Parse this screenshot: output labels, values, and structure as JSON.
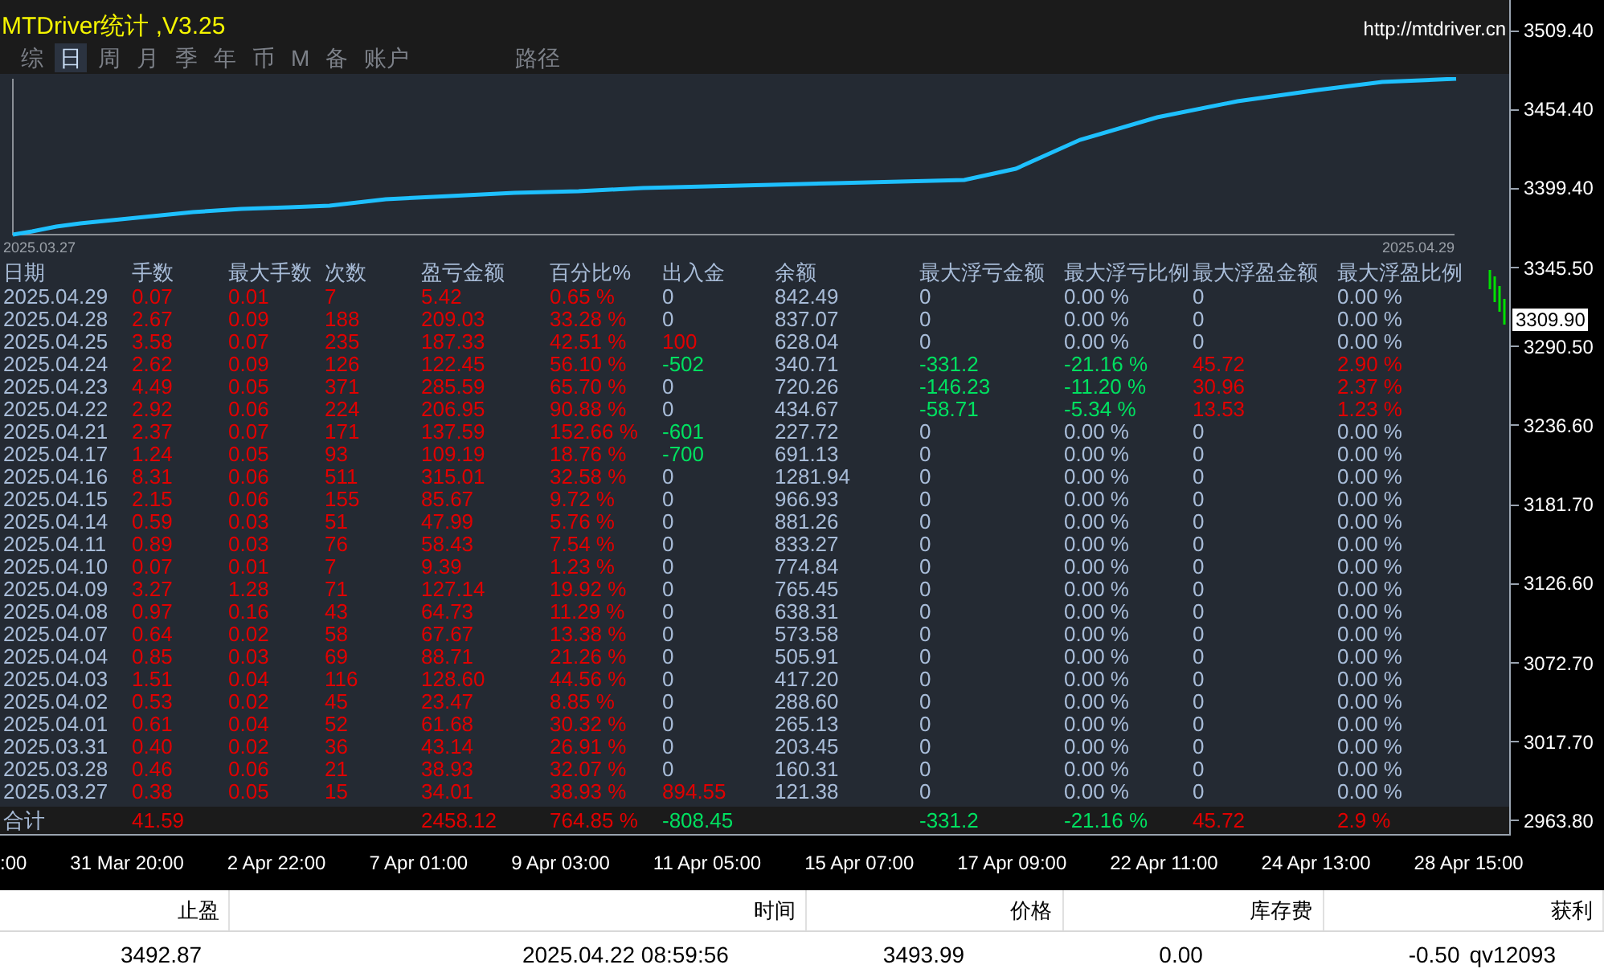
{
  "panel": {
    "title": "MTDriver统计 ,V3.25",
    "url": "http://mtdriver.cn",
    "tabs": [
      {
        "label": "综",
        "selected": false
      },
      {
        "label": "日",
        "selected": true
      },
      {
        "label": "周",
        "selected": false
      },
      {
        "label": "月",
        "selected": false
      },
      {
        "label": "季",
        "selected": false
      },
      {
        "label": "年",
        "selected": false
      },
      {
        "label": "币",
        "selected": false
      },
      {
        "label": "M",
        "selected": false
      },
      {
        "label": "备",
        "selected": false
      },
      {
        "label": "账户",
        "selected": false
      },
      {
        "label": "路径",
        "selected": false
      }
    ],
    "equity_chart": {
      "start_label": "2025.03.27",
      "end_label": "2025.04.29"
    },
    "table": {
      "columns": [
        {
          "label": "日期",
          "color": "#a8bcd8"
        },
        {
          "label": "手数",
          "color": "#e00000"
        },
        {
          "label": "最大手数",
          "color": "#e00000"
        },
        {
          "label": "次数",
          "color": "#e00000"
        },
        {
          "label": "盈亏金额",
          "color": "#e00000"
        },
        {
          "label": "百分比%",
          "color": "#e00000"
        },
        {
          "label": "出入金",
          "color": "#a8bcd8"
        },
        {
          "label": "余额",
          "color": "#a8bcd8"
        },
        {
          "label": "最大浮亏金额",
          "color": "#a8bcd8"
        },
        {
          "label": "最大浮亏比例",
          "color": "#a8bcd8"
        },
        {
          "label": "最大浮盈金额",
          "color": "#a8bcd8"
        },
        {
          "label": "最大浮盈比例",
          "color": "#a8bcd8"
        }
      ],
      "rows": [
        [
          "2025.04.29",
          "0.07",
          "0.01",
          "7",
          "5.42",
          "0.65 %",
          "0",
          "842.49",
          "0",
          "0.00 %",
          "0",
          "0.00 %"
        ],
        [
          "2025.04.28",
          "2.67",
          "0.09",
          "188",
          "209.03",
          "33.28 %",
          "0",
          "837.07",
          "0",
          "0.00 %",
          "0",
          "0.00 %"
        ],
        [
          "2025.04.25",
          "3.58",
          "0.07",
          "235",
          "187.33",
          "42.51 %",
          {
            "text": "100",
            "color": "#e00000"
          },
          "628.04",
          "0",
          "0.00 %",
          "0",
          "0.00 %"
        ],
        [
          "2025.04.24",
          "2.62",
          "0.09",
          "126",
          "122.45",
          "56.10 %",
          {
            "text": "-502",
            "color": "#00e060"
          },
          "340.71",
          {
            "text": "-331.2",
            "color": "#00e060"
          },
          {
            "text": "-21.16 %",
            "color": "#00e060"
          },
          {
            "text": "45.72",
            "color": "#e00000"
          },
          {
            "text": "2.90 %",
            "color": "#e00000"
          }
        ],
        [
          "2025.04.23",
          "4.49",
          "0.05",
          "371",
          "285.59",
          "65.70 %",
          "0",
          "720.26",
          {
            "text": "-146.23",
            "color": "#00e060"
          },
          {
            "text": "-11.20 %",
            "color": "#00e060"
          },
          {
            "text": "30.96",
            "color": "#e00000"
          },
          {
            "text": "2.37 %",
            "color": "#e00000"
          }
        ],
        [
          "2025.04.22",
          "2.92",
          "0.06",
          "224",
          "206.95",
          "90.88 %",
          "0",
          "434.67",
          {
            "text": "-58.71",
            "color": "#00e060"
          },
          {
            "text": "-5.34 %",
            "color": "#00e060"
          },
          {
            "text": "13.53",
            "color": "#e00000"
          },
          {
            "text": "1.23 %",
            "color": "#e00000"
          }
        ],
        [
          "2025.04.21",
          "2.37",
          "0.07",
          "171",
          "137.59",
          "152.66 %",
          {
            "text": "-601",
            "color": "#00e060"
          },
          "227.72",
          "0",
          "0.00 %",
          "0",
          "0.00 %"
        ],
        [
          "2025.04.17",
          "1.24",
          "0.05",
          "93",
          "109.19",
          "18.76 %",
          {
            "text": "-700",
            "color": "#00e060"
          },
          "691.13",
          "0",
          "0.00 %",
          "0",
          "0.00 %"
        ],
        [
          "2025.04.16",
          "8.31",
          "0.06",
          "511",
          "315.01",
          "32.58 %",
          "0",
          "1281.94",
          "0",
          "0.00 %",
          "0",
          "0.00 %"
        ],
        [
          "2025.04.15",
          "2.15",
          "0.06",
          "155",
          "85.67",
          "9.72 %",
          "0",
          "966.93",
          "0",
          "0.00 %",
          "0",
          "0.00 %"
        ],
        [
          "2025.04.14",
          "0.59",
          "0.03",
          "51",
          "47.99",
          "5.76 %",
          "0",
          "881.26",
          "0",
          "0.00 %",
          "0",
          "0.00 %"
        ],
        [
          "2025.04.11",
          "0.89",
          "0.03",
          "76",
          "58.43",
          "7.54 %",
          "0",
          "833.27",
          "0",
          "0.00 %",
          "0",
          "0.00 %"
        ],
        [
          "2025.04.10",
          "0.07",
          "0.01",
          "7",
          "9.39",
          "1.23 %",
          "0",
          "774.84",
          "0",
          "0.00 %",
          "0",
          "0.00 %"
        ],
        [
          "2025.04.09",
          "3.27",
          "1.28",
          "71",
          "127.14",
          "19.92 %",
          "0",
          "765.45",
          "0",
          "0.00 %",
          "0",
          "0.00 %"
        ],
        [
          "2025.04.08",
          "0.97",
          "0.16",
          "43",
          "64.73",
          "11.29 %",
          "0",
          "638.31",
          "0",
          "0.00 %",
          "0",
          "0.00 %"
        ],
        [
          "2025.04.07",
          "0.64",
          "0.02",
          "58",
          "67.67",
          "13.38 %",
          "0",
          "573.58",
          "0",
          "0.00 %",
          "0",
          "0.00 %"
        ],
        [
          "2025.04.04",
          "0.85",
          "0.03",
          "69",
          "88.71",
          "21.26 %",
          "0",
          "505.91",
          "0",
          "0.00 %",
          "0",
          "0.00 %"
        ],
        [
          "2025.04.03",
          "1.51",
          "0.04",
          "116",
          "128.60",
          "44.56 %",
          "0",
          "417.20",
          "0",
          "0.00 %",
          "0",
          "0.00 %"
        ],
        [
          "2025.04.02",
          "0.53",
          "0.02",
          "45",
          "23.47",
          "8.85 %",
          "0",
          "288.60",
          "0",
          "0.00 %",
          "0",
          "0.00 %"
        ],
        [
          "2025.04.01",
          "0.61",
          "0.04",
          "52",
          "61.68",
          "30.32 %",
          "0",
          "265.13",
          "0",
          "0.00 %",
          "0",
          "0.00 %"
        ],
        [
          "2025.03.31",
          "0.40",
          "0.02",
          "36",
          "43.14",
          "26.91 %",
          "0",
          "203.45",
          "0",
          "0.00 %",
          "0",
          "0.00 %"
        ],
        [
          "2025.03.28",
          "0.46",
          "0.06",
          "21",
          "38.93",
          "32.07 %",
          "0",
          "160.31",
          "0",
          "0.00 %",
          "0",
          "0.00 %"
        ],
        [
          "2025.03.27",
          "0.38",
          "0.05",
          "15",
          "34.01",
          "38.93 %",
          {
            "text": "894.55",
            "color": "#e00000"
          },
          "121.38",
          "0",
          "0.00 %",
          "0",
          "0.00 %"
        ]
      ],
      "total": {
        "label": {
          "text": "合计",
          "color": "#a8bcd8"
        },
        "lots": {
          "text": "41.59",
          "color": "#e00000"
        },
        "pnl": {
          "text": "2458.12",
          "color": "#e00000"
        },
        "pct": {
          "text": "764.85 %",
          "color": "#e00000"
        },
        "flow": {
          "text": "-808.45",
          "color": "#00e060"
        },
        "max_float_loss": {
          "text": "-331.2",
          "color": "#00e060"
        },
        "max_float_loss_pct": {
          "text": "-21.16 %",
          "color": "#00e060"
        },
        "max_float_profit": {
          "text": "45.72",
          "color": "#e00000"
        },
        "max_float_profit_pct": {
          "text": "2.9 %",
          "color": "#e00000"
        }
      }
    }
  },
  "price_axis": {
    "labels": [
      "3509.40",
      "3454.40",
      "3399.40",
      "3345.50",
      "3290.50",
      "3236.60",
      "3181.70",
      "3126.60",
      "3072.70",
      "3017.70",
      "2963.80"
    ],
    "current_price": "3309.90"
  },
  "time_axis": [
    ":00",
    "31 Mar 20:00",
    "2 Apr 22:00",
    "7 Apr 01:00",
    "9 Apr 03:00",
    "11 Apr 05:00",
    "15 Apr 07:00",
    "17 Apr 09:00",
    "22 Apr 11:00",
    "24 Apr 13:00",
    "28 Apr 15:00"
  ],
  "orders": {
    "columns": [
      "止盈",
      "时间",
      "价格",
      "库存费",
      "获利"
    ],
    "row": [
      "3492.87",
      "2025.04.22 08:59:56",
      "3493.99",
      "0.00",
      "-0.50",
      "qv12093"
    ]
  }
}
